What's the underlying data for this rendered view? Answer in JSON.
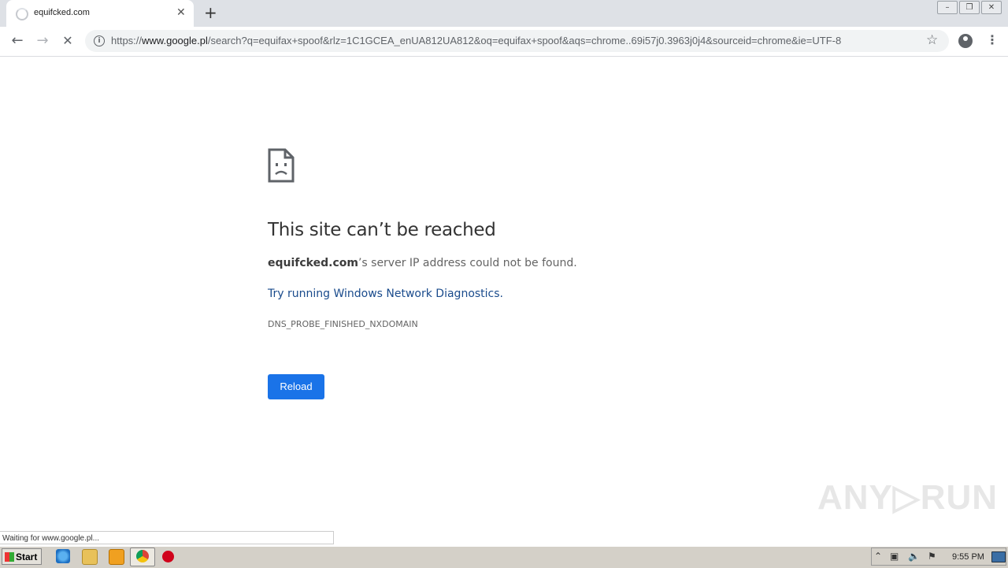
{
  "tab": {
    "title": "equifcked.com",
    "close_glyph": "✕",
    "new_tab_glyph": "+"
  },
  "window_controls": {
    "minimize": "–",
    "restore": "❐",
    "close": "✕"
  },
  "toolbar": {
    "back_glyph": "←",
    "forward_glyph": "→",
    "stop_glyph": "✕",
    "url_prefix": "https://",
    "url_host": "www.google.pl",
    "url_path": "/search?q=equifax+spoof&rlz=1C1GCEA_enUA812UA812&oq=equifax+spoof&aqs=chrome..69i57j0.3963j0j4&sourceid=chrome&ie=UTF-8",
    "star_glyph": "☆",
    "menu_glyph": "⋮"
  },
  "error": {
    "title": "This site can’t be reached",
    "domain": "equifcked.com",
    "message_suffix": "’s server IP address could not be found.",
    "diagnostics_link": "Try running Windows Network Diagnostics",
    "diagnostics_period": ".",
    "code": "DNS_PROBE_FINISHED_NXDOMAIN",
    "reload_label": "Reload"
  },
  "status_bar": {
    "text": "Waiting for www.google.pl..."
  },
  "watermark": {
    "text": "ANY▷RUN"
  },
  "taskbar": {
    "start_label": "Start",
    "clock": "9:55 PM",
    "tray_glyphs": [
      "⌃",
      "▣",
      "🔈",
      "⚑"
    ]
  },
  "colors": {
    "link": "#1a4b8c",
    "reload_button": "#1a73e8",
    "tabstrip": "#dee1e6"
  }
}
